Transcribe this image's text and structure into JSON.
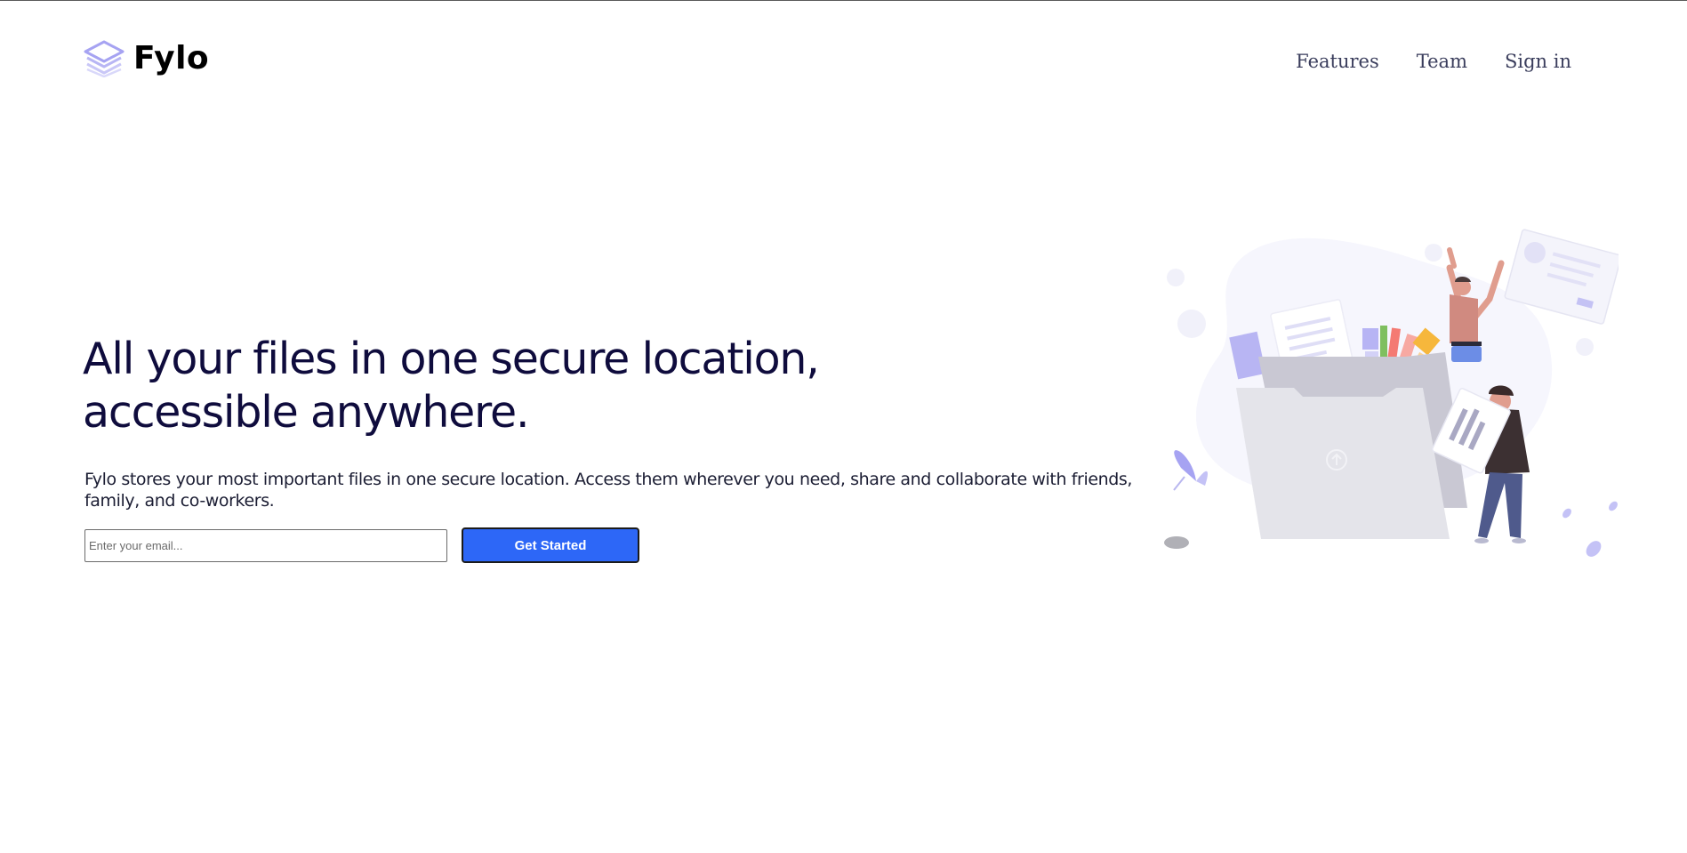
{
  "brand": {
    "name": "Fylo",
    "logo_icon": "layers-icon",
    "accent_color": "#a6a3f2"
  },
  "nav": {
    "items": [
      {
        "label": "Features"
      },
      {
        "label": "Team"
      },
      {
        "label": "Sign in"
      }
    ]
  },
  "hero": {
    "title_line1": "All your files in one secure location,",
    "title_line2": "accessible anywhere.",
    "description": "Fylo stores your most important files in one secure location. Access them wherever you need, share and collaborate with friends, family, and co-workers.",
    "email_placeholder": "Enter your email...",
    "cta_label": "Get Started",
    "cta_color": "#2d67f7",
    "title_color": "#0f0c3d"
  },
  "illustration": {
    "icon": "file-folder-illustration"
  }
}
